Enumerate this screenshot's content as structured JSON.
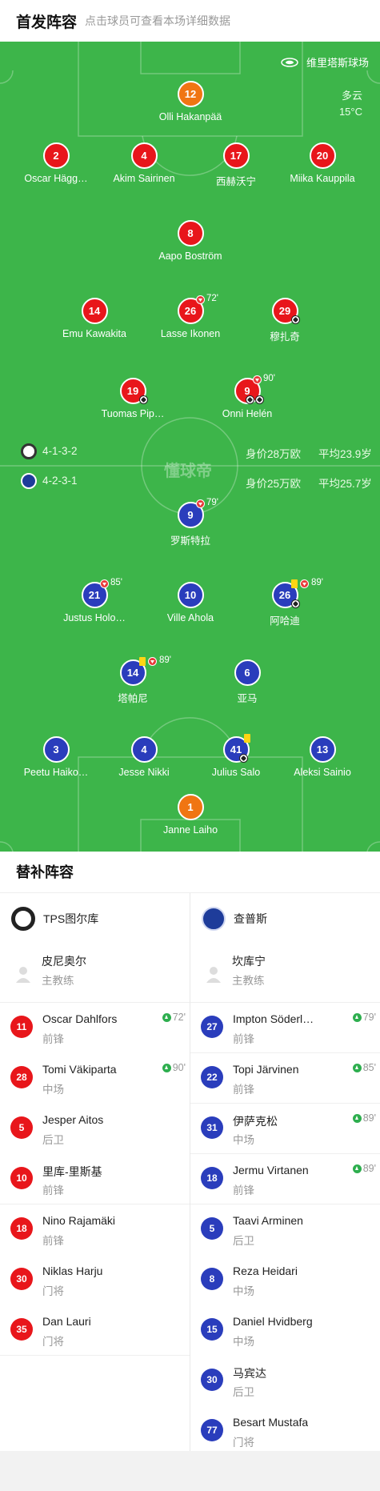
{
  "header": {
    "title": "首发阵容",
    "subtitle": "点击球员可查看本场详细数据"
  },
  "venue": "维里塔斯球场",
  "weather": {
    "condition": "多云",
    "temp": "15°C"
  },
  "watermark": "懂球帝",
  "colors": {
    "home": "#e8161b",
    "away": "#2a3dbc",
    "keeper": "#f07512",
    "pitch": "#3db54a"
  },
  "home": {
    "formation": "4-1-3-2",
    "value": "身价28万欧",
    "avg_age": "平均23.9岁",
    "players": [
      {
        "no": "12",
        "name": "Olli Hakanpää"
      },
      {
        "no": "2",
        "name": "Oscar Hägg…"
      },
      {
        "no": "4",
        "name": "Akim Sairinen"
      },
      {
        "no": "17",
        "name": "西赫沃宁"
      },
      {
        "no": "20",
        "name": "Miika Kauppila"
      },
      {
        "no": "8",
        "name": "Aapo Boström"
      },
      {
        "no": "14",
        "name": "Emu Kawakita"
      },
      {
        "no": "26",
        "name": "Lasse Ikonen",
        "sub": "72'"
      },
      {
        "no": "29",
        "name": "穆扎奇"
      },
      {
        "no": "19",
        "name": "Tuomas Pip…"
      },
      {
        "no": "9",
        "name": "Onni Helén",
        "sub": "90'"
      }
    ]
  },
  "away": {
    "formation": "4-2-3-1",
    "value": "身价25万欧",
    "avg_age": "平均25.7岁",
    "players": [
      {
        "no": "9",
        "name": "罗斯特拉",
        "sub": "79'"
      },
      {
        "no": "21",
        "name": "Justus Holo…",
        "sub": "85'"
      },
      {
        "no": "10",
        "name": "Ville Ahola"
      },
      {
        "no": "26",
        "name": "阿哈迪",
        "sub": "89'"
      },
      {
        "no": "14",
        "name": "塔帕尼",
        "sub": "89'"
      },
      {
        "no": "6",
        "name": "亚马"
      },
      {
        "no": "3",
        "name": "Peetu Haiko…"
      },
      {
        "no": "4",
        "name": "Jesse Nikki"
      },
      {
        "no": "41",
        "name": "Julius Salo"
      },
      {
        "no": "13",
        "name": "Aleksi Sainio"
      },
      {
        "no": "1",
        "name": "Janne Laiho"
      }
    ]
  },
  "subs": {
    "title": "替补阵容",
    "home": {
      "team": "TPS图尔库",
      "coach": {
        "name": "皮尼奥尔",
        "role": "主教练"
      },
      "players": [
        {
          "no": "11",
          "name": "Oscar Dahlfors",
          "pos": "前锋",
          "in": "72'"
        },
        {
          "no": "28",
          "name": "Tomi Väkiparta",
          "pos": "中场",
          "in": "90'"
        },
        {
          "no": "5",
          "name": "Jesper Aitos",
          "pos": "后卫"
        },
        {
          "no": "10",
          "name": "里库-里斯基",
          "pos": "前锋"
        },
        {
          "no": "18",
          "name": "Nino Rajamäki",
          "pos": "前锋"
        },
        {
          "no": "30",
          "name": "Niklas Harju",
          "pos": "门将"
        },
        {
          "no": "35",
          "name": "Dan Lauri",
          "pos": "门将"
        }
      ]
    },
    "away": {
      "team": "查普斯",
      "coach": {
        "name": "坎库宁",
        "role": "主教练"
      },
      "players": [
        {
          "no": "27",
          "name": "Impton Söderl…",
          "pos": "前锋",
          "in": "79'"
        },
        {
          "no": "22",
          "name": "Topi Järvinen",
          "pos": "前锋",
          "in": "85'"
        },
        {
          "no": "31",
          "name": "伊萨克松",
          "pos": "中场",
          "in": "89'"
        },
        {
          "no": "18",
          "name": "Jermu Virtanen",
          "pos": "前锋",
          "in": "89'"
        },
        {
          "no": "5",
          "name": "Taavi Arminen",
          "pos": "后卫"
        },
        {
          "no": "8",
          "name": "Reza Heidari",
          "pos": "中场"
        },
        {
          "no": "15",
          "name": "Daniel Hvidberg",
          "pos": "中场"
        },
        {
          "no": "30",
          "name": "马宾达",
          "pos": "后卫"
        },
        {
          "no": "77",
          "name": "Besart Mustafa",
          "pos": "门将"
        }
      ]
    }
  }
}
